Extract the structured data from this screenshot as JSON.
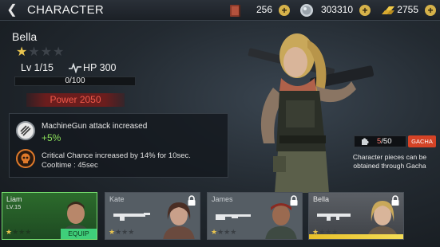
{
  "header": {
    "title": "CHARACTER",
    "back_icon": "back-arrow-icon"
  },
  "resources": [
    {
      "name": "book",
      "icon": "book-icon",
      "value": "256"
    },
    {
      "name": "silver",
      "icon": "silver-coin-icon",
      "value": "303310"
    },
    {
      "name": "gold",
      "icon": "gold-bars-icon",
      "value": "2755"
    }
  ],
  "character": {
    "name": "Bella",
    "stars": 1,
    "max_stars": 4,
    "level_label": "Lv 1/15",
    "hp_label": "HP 300",
    "xp_text": "0/100",
    "xp_progress": 0,
    "power_label": "Power 2050"
  },
  "skills": {
    "skill1_desc": "MachineGun attack increased",
    "skill1_bonus": "+5%",
    "skill2_desc": "Critical Chance increased by 14% for 10sec.",
    "skill2_cooldown": "Cooltime : 45sec"
  },
  "gacha": {
    "pieces_current": "5",
    "pieces_total": "/50",
    "button_label": "GACHA",
    "info_line1": "Character pieces can be",
    "info_line2": "obtained through Gacha"
  },
  "roster": [
    {
      "name": "Liam",
      "level": "LV.15",
      "stars": 1,
      "status": "equipped",
      "action_label": "EQUIP"
    },
    {
      "name": "Kate",
      "level": "",
      "stars": 1,
      "status": "locked"
    },
    {
      "name": "James",
      "level": "",
      "stars": 1,
      "status": "locked"
    },
    {
      "name": "Bella",
      "level": "",
      "stars": 1,
      "status": "locked"
    }
  ],
  "colors": {
    "accent_gold": "#e8c44f",
    "power_red": "#f1594a",
    "bonus_green": "#8be05a",
    "equip_green": "#3fcf7a",
    "gacha_orange": "#d54326"
  }
}
